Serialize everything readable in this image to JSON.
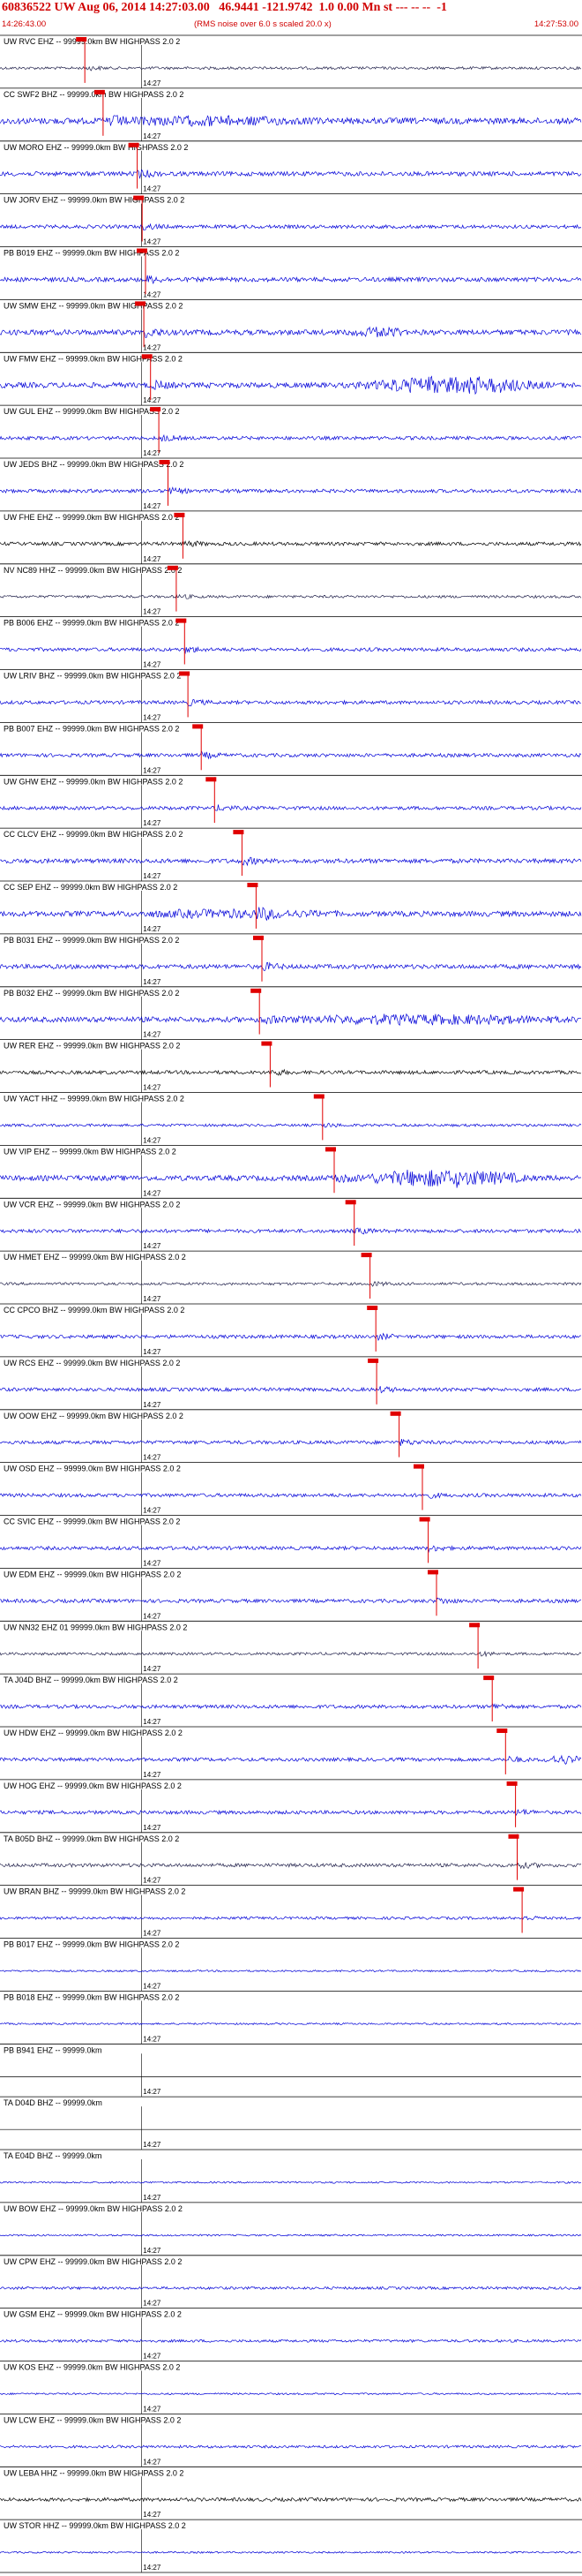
{
  "header": {
    "title": "60836522 UW Aug 06, 2014 14:27:03.00   46.9441 -121.9742  1.0 0.00 Mn st --- -- --  -1",
    "subtitle": "(RMS noise over 6.0 s scaled 20.0 x)",
    "time_start": "14:26:43.00",
    "time_end": "14:27:53.00"
  },
  "colors": {
    "background": "#ffffff",
    "header_text": "#d00000",
    "pick_marker": "#e00000",
    "trace_blue": "#0000d8",
    "trace_dark": "#20204a",
    "trace_black": "#000000",
    "gridline": "#000000"
  },
  "chart_data": {
    "type": "line",
    "title": "60836522 UW Aug 06, 2014 14:27:03.00   46.9441 -121.9742  1.0 0.00 Mn st --- -- --  -1",
    "subtitle": "(RMS noise over 6.0 s scaled 20.0 x)",
    "x_axis": {
      "start": "14:26:43.00",
      "end": "14:27:53.00",
      "range_seconds": [
        0,
        70
      ],
      "minute_tick_label": "14:27",
      "minute_tick_seconds": 17
    },
    "grid": false,
    "traces": [
      {
        "label": "UW RVC EHZ -- 99999.0km BW  HIGHPASS  2.0  2",
        "pick_s": 10.2,
        "color": "dark",
        "amp": 1.5
      },
      {
        "label": "CC SWF2 BHZ -- 99999.0km BW  HIGHPASS  2.0  2",
        "pick_s": 12.4,
        "color": "blue",
        "amp": 3.5,
        "burst": [
          0.16,
          0.55,
          3.2
        ]
      },
      {
        "label": "UW MORO EHZ -- 99999.0km BW  HIGHPASS  2.0  2",
        "pick_s": 16.5,
        "color": "blue",
        "amp": 2.5
      },
      {
        "label": "UW JORV EHZ -- 99999.0km BW  HIGHPASS  2.0  2",
        "pick_s": 17.1,
        "color": "blue",
        "amp": 2.0
      },
      {
        "label": "PB B019 EHZ -- 99999.0km BW  HIGHPASS  2.0  2",
        "pick_s": 17.5,
        "color": "blue",
        "amp": 2.5
      },
      {
        "label": "UW SMW EHZ -- 99999.0km BW  HIGHPASS  2.0  2",
        "pick_s": 17.3,
        "color": "blue",
        "amp": 3.0,
        "burst": [
          0.6,
          0.7,
          4.0
        ]
      },
      {
        "label": "UW FMW EHZ -- 99999.0km BW  HIGHPASS  2.0  2",
        "pick_s": 18.1,
        "color": "blue",
        "amp": 3.0,
        "burst": [
          0.6,
          0.95,
          9.0
        ]
      },
      {
        "label": "UW GUL EHZ -- 99999.0km BW  HIGHPASS  2.0  2",
        "pick_s": 19.1,
        "color": "blue",
        "amp": 2.0
      },
      {
        "label": "UW JEDS BHZ -- 99999.0km BW  HIGHPASS  2.0  2",
        "pick_s": 20.2,
        "color": "blue",
        "amp": 2.0
      },
      {
        "label": "UW FHE EHZ -- 99999.0km BW  HIGHPASS  2.0  2",
        "pick_s": 22.0,
        "color": "black",
        "amp": 2.0
      },
      {
        "label": "NV NC89 HHZ -- 99999.0km BW  HIGHPASS  2.0  2",
        "pick_s": 21.2,
        "color": "dark",
        "amp": 1.5
      },
      {
        "label": "PB B006 EHZ -- 99999.0km BW  HIGHPASS  2.0  2",
        "pick_s": 22.2,
        "color": "blue",
        "amp": 2.0
      },
      {
        "label": "UW LRIV BHZ -- 99999.0km BW  HIGHPASS  2.0  2",
        "pick_s": 22.6,
        "color": "blue",
        "amp": 2.0
      },
      {
        "label": "PB B007 EHZ -- 99999.0km BW  HIGHPASS  2.0  2",
        "pick_s": 24.2,
        "color": "blue",
        "amp": 2.0
      },
      {
        "label": "UW GHW EHZ -- 99999.0km BW  HIGHPASS  2.0  2",
        "pick_s": 25.8,
        "color": "blue",
        "amp": 2.0
      },
      {
        "label": "CC CLCV EHZ -- 99999.0km BW  HIGHPASS  2.0  2",
        "pick_s": 29.1,
        "color": "blue",
        "amp": 2.5
      },
      {
        "label": "CC SEP EHZ -- 99999.0km BW  HIGHPASS  2.0  2",
        "pick_s": 30.8,
        "color": "blue",
        "amp": 3.0,
        "burst": [
          0.2,
          0.6,
          3.0
        ]
      },
      {
        "label": "PB B031 EHZ -- 99999.0km BW  HIGHPASS  2.0  2",
        "pick_s": 31.5,
        "color": "blue",
        "amp": 2.5
      },
      {
        "label": "PB B032 EHZ -- 99999.0km BW  HIGHPASS  2.0  2",
        "pick_s": 31.2,
        "color": "blue",
        "amp": 3.0,
        "burst": [
          0.46,
          1.0,
          4.0
        ]
      },
      {
        "label": "UW RER EHZ -- 99999.0km BW  HIGHPASS  2.0  2",
        "pick_s": 32.5,
        "color": "black",
        "amp": 2.0
      },
      {
        "label": "UW YACT HHZ -- 99999.0km BW  HIGHPASS  2.0  2",
        "pick_s": 38.8,
        "color": "blue",
        "amp": 1.5
      },
      {
        "label": "UW VIP EHZ -- 99999.0km BW  HIGHPASS  2.0  2",
        "pick_s": 40.2,
        "color": "blue",
        "amp": 3.0,
        "burst": [
          0.6,
          0.92,
          9.0
        ]
      },
      {
        "label": "UW VCR EHZ -- 99999.0km BW  HIGHPASS  2.0  2",
        "pick_s": 42.6,
        "color": "blue",
        "amp": 2.0
      },
      {
        "label": "UW HMET EHZ -- 99999.0km BW  HIGHPASS  2.0  2",
        "pick_s": 44.5,
        "color": "dark",
        "amp": 1.5
      },
      {
        "label": "CC CPCO BHZ -- 99999.0km BW  HIGHPASS  2.0  2",
        "pick_s": 45.2,
        "color": "blue",
        "amp": 2.0
      },
      {
        "label": "UW RCS EHZ -- 99999.0km BW  HIGHPASS  2.0  2",
        "pick_s": 45.3,
        "color": "blue",
        "amp": 2.0
      },
      {
        "label": "UW OOW EHZ -- 99999.0km BW  HIGHPASS  2.0  2",
        "pick_s": 48.0,
        "color": "blue",
        "amp": 2.0
      },
      {
        "label": "UW OSD EHZ -- 99999.0km BW  HIGHPASS  2.0  2",
        "pick_s": 50.8,
        "color": "blue",
        "amp": 2.0
      },
      {
        "label": "CC SVIC EHZ -- 99999.0km BW  HIGHPASS  2.0  2",
        "pick_s": 51.5,
        "color": "blue",
        "amp": 2.0
      },
      {
        "label": "UW EDM EHZ -- 99999.0km BW  HIGHPASS  2.0  2",
        "pick_s": 52.5,
        "color": "blue",
        "amp": 2.0
      },
      {
        "label": "UW NN32 EHZ 01 99999.0km BW  HIGHPASS  2.0  2",
        "pick_s": 57.5,
        "color": "dark",
        "amp": 1.5
      },
      {
        "label": "TA J04D BHZ -- 99999.0km BW  HIGHPASS  2.0  2",
        "pick_s": 59.2,
        "color": "blue",
        "amp": 2.0
      },
      {
        "label": "UW HDW EHZ -- 99999.0km BW  HIGHPASS  2.0  2",
        "pick_s": 60.8,
        "color": "blue",
        "amp": 2.0,
        "burst": [
          0.93,
          1.0,
          5.0
        ]
      },
      {
        "label": "UW HOG EHZ -- 99999.0km BW  HIGHPASS  2.0  2",
        "pick_s": 62.0,
        "color": "blue",
        "amp": 2.0
      },
      {
        "label": "TA B05D BHZ -- 99999.0km BW  HIGHPASS  2.0  2",
        "pick_s": 62.2,
        "color": "dark",
        "amp": 2.0
      },
      {
        "label": "UW BRAN BHZ -- 99999.0km BW  HIGHPASS  2.0  2",
        "pick_s": 62.8,
        "color": "blue",
        "amp": 1.5
      },
      {
        "label": "PB B017 EHZ -- 99999.0km BW  HIGHPASS  2.0  2",
        "pick_s": null,
        "color": "blue",
        "amp": 1.0
      },
      {
        "label": "PB B018 EHZ -- 99999.0km BW  HIGHPASS  2.0  2",
        "pick_s": null,
        "color": "blue",
        "amp": 1.0
      },
      {
        "label": "PB B941 EHZ -- 99999.0km",
        "pick_s": null,
        "color": "flat",
        "amp": 0
      },
      {
        "label": "TA D04D BHZ -- 99999.0km",
        "pick_s": null,
        "color": "flat",
        "amp": 0
      },
      {
        "label": "TA E04D BHZ -- 99999.0km",
        "pick_s": null,
        "color": "blue",
        "amp": 1.0
      },
      {
        "label": "UW BOW EHZ -- 99999.0km BW  HIGHPASS  2.0  2",
        "pick_s": null,
        "color": "blue",
        "amp": 1.0
      },
      {
        "label": "UW CPW EHZ -- 99999.0km BW  HIGHPASS  2.0  2",
        "pick_s": null,
        "color": "blue",
        "amp": 1.5
      },
      {
        "label": "UW GSM EHZ -- 99999.0km BW  HIGHPASS  2.0  2",
        "pick_s": null,
        "color": "blue",
        "amp": 1.5
      },
      {
        "label": "UW KOS EHZ -- 99999.0km BW  HIGHPASS  2.0  2",
        "pick_s": null,
        "color": "blue",
        "amp": 1.0
      },
      {
        "label": "UW LCW EHZ -- 99999.0km BW  HIGHPASS  2.0  2",
        "pick_s": null,
        "color": "blue",
        "amp": 1.5
      },
      {
        "label": "UW LEBA HHZ -- 99999.0km BW  HIGHPASS  2.0  2",
        "pick_s": null,
        "color": "black",
        "amp": 2.0
      },
      {
        "label": "UW STOR HHZ -- 99999.0km BW  HIGHPASS  2.0  2",
        "pick_s": null,
        "color": "blue",
        "amp": 1.0
      }
    ]
  }
}
